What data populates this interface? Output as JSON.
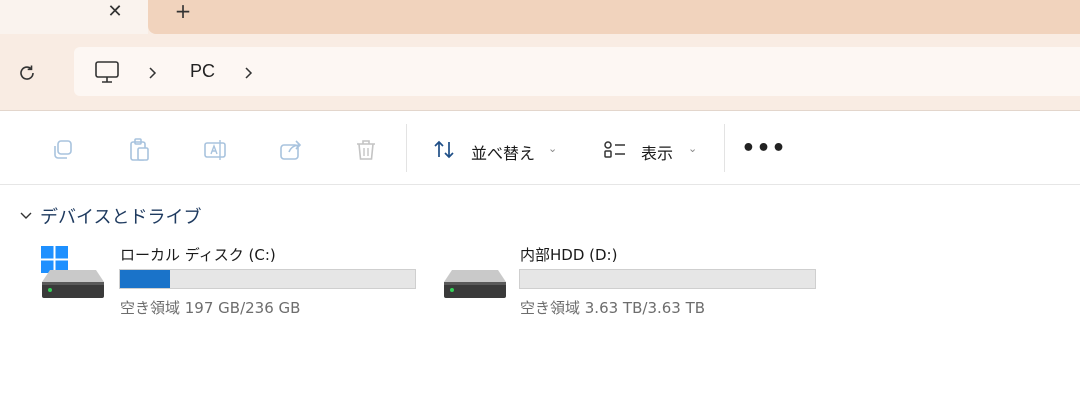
{
  "tabs": {
    "close_glyph": "✕",
    "new_tab_glyph": "+"
  },
  "address_bar": {
    "breadcrumb": [
      "PC"
    ]
  },
  "command_bar": {
    "sort_label": "並べ替え",
    "view_label": "表示",
    "more_glyph": "•••",
    "caret_glyph": "⌄"
  },
  "content": {
    "group_title": "デバイスとドライブ",
    "drives": [
      {
        "name": "ローカル ディスク (C:)",
        "space": "空き領域 197 GB/236 GB",
        "used_fraction": 0.17,
        "has_windows_logo": true
      },
      {
        "name": "内部HDD (D:)",
        "space": "空き領域 3.63 TB/3.63 TB",
        "used_fraction": 0.0,
        "has_windows_logo": false
      }
    ]
  },
  "colors": {
    "accent": "#1a73c9",
    "chrome": "#f9ece3",
    "inactive_tab": "#f1d3bd",
    "group_title": "#1e3a5f"
  }
}
